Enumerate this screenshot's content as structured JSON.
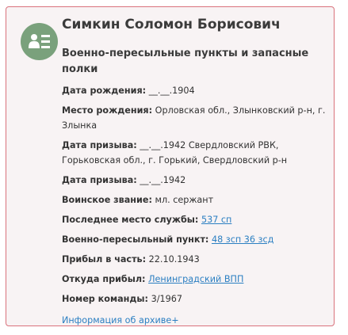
{
  "person": {
    "name": "Симкин Соломон Борисович",
    "unit": "Военно-пересыльные пункты и запасные полки"
  },
  "fields": [
    {
      "label": "Дата рождения:",
      "value": "__.__.1904"
    },
    {
      "label": "Место рождения:",
      "value": "Орловская обл., Злынковский р-н, г. Злынка"
    },
    {
      "label": "Дата призыва:",
      "value": "__.__.1942 Свердловский РВК, Горьковская обл., г. Горький, Свердловский р-н"
    },
    {
      "label": "Дата призыва:",
      "value": "__.__.1942"
    },
    {
      "label": "Воинское звание:",
      "value": "мл. сержант"
    },
    {
      "label": "Последнее место службы:",
      "link": "537 сп"
    },
    {
      "label": "Военно-пересыльный пункт:",
      "link": "48 зсп 36 зсд"
    },
    {
      "label": "Прибыл в часть:",
      "value": "22.10.1943"
    },
    {
      "label": "Откуда прибыл:",
      "link": "Ленинградский ВПП"
    },
    {
      "label": "Номер команды:",
      "value": "3/1967"
    }
  ],
  "archive_link": "Информация об архиве+",
  "colors": {
    "card_border": "#d9727c",
    "card_background": "#f8f3f4",
    "avatar": "#7aa17c",
    "link": "#2b7fc2"
  },
  "icons": {
    "avatar": "person-list-icon"
  }
}
